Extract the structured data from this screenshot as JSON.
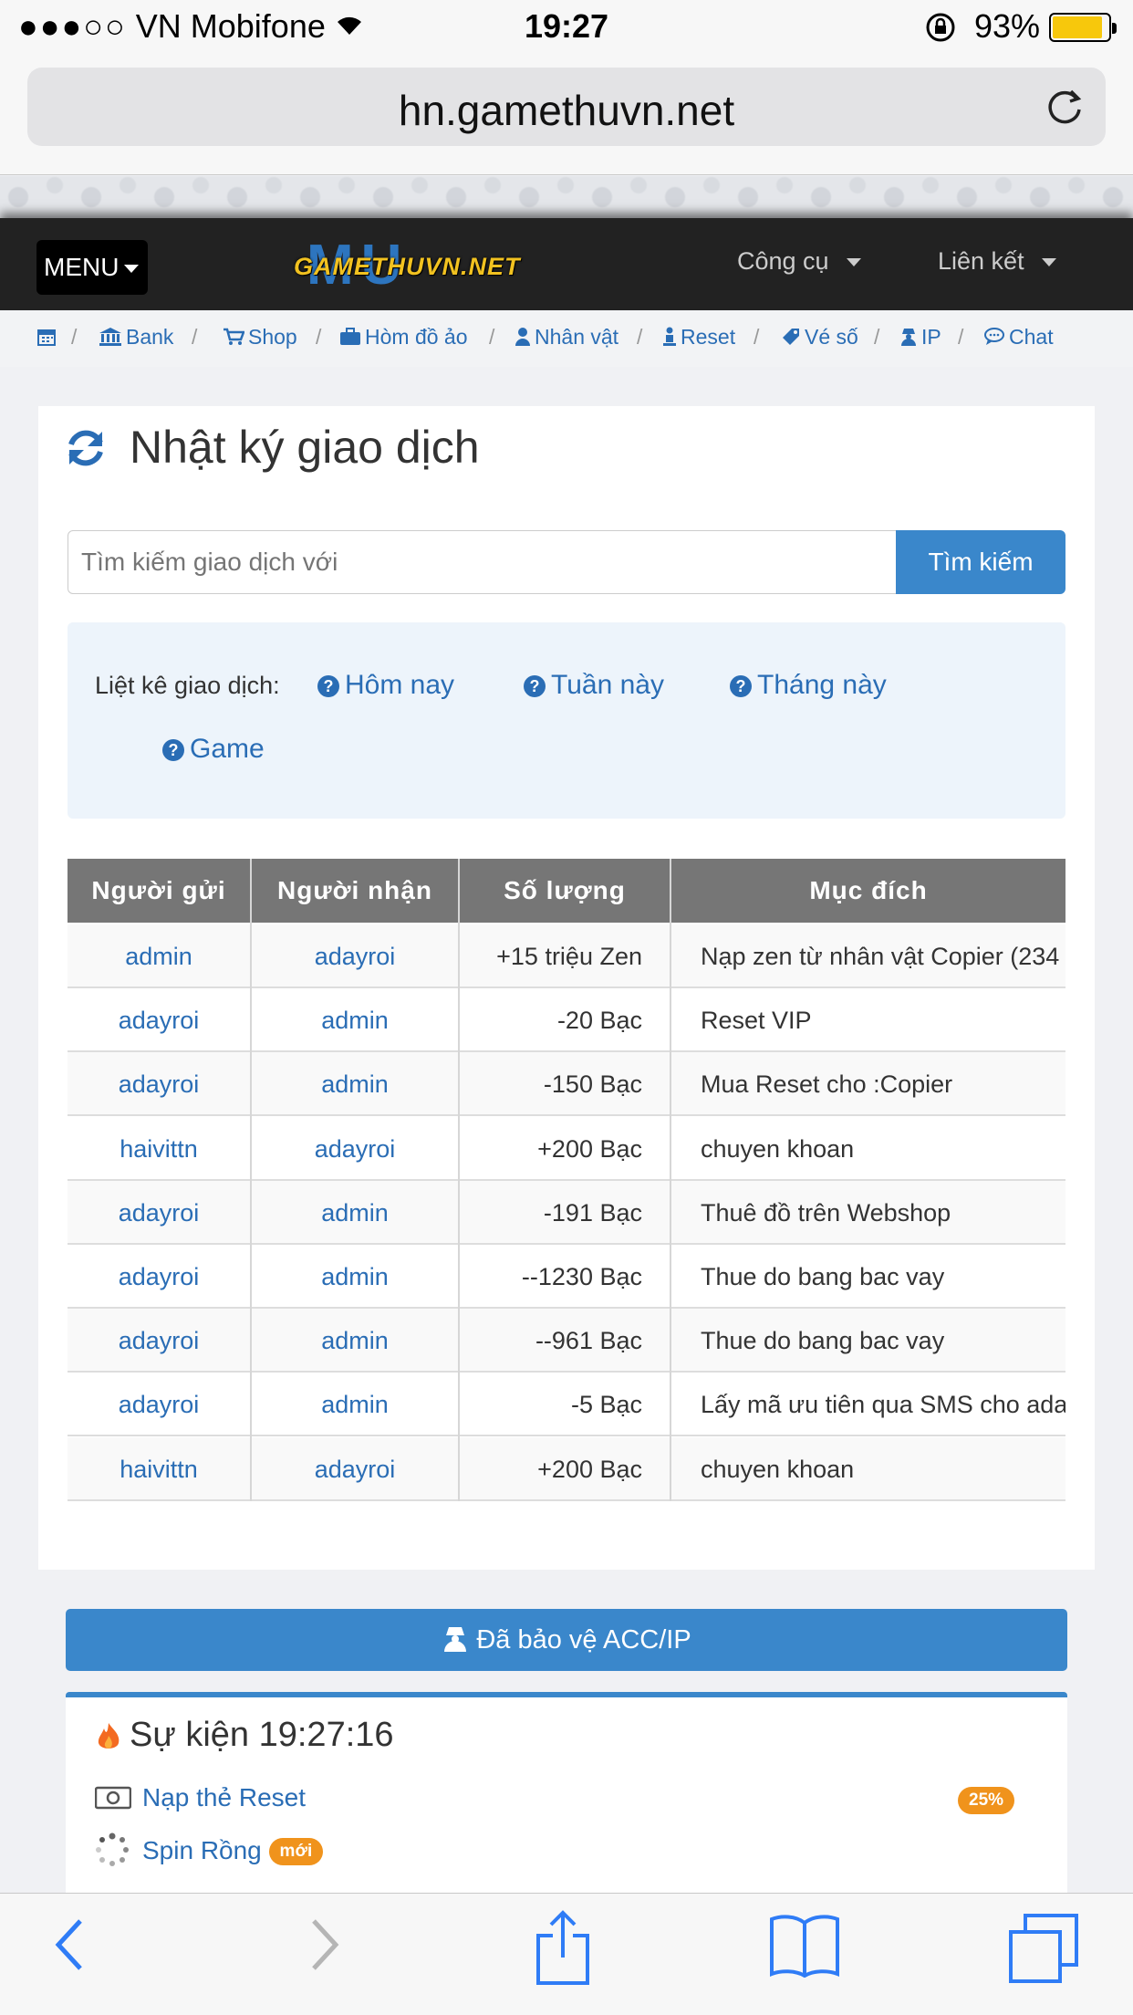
{
  "status_bar": {
    "signal": "●●●○○",
    "carrier": "VN Mobifone",
    "time": "19:27",
    "battery_percent": "93%"
  },
  "browser": {
    "url": "hn.gamethuvn.net"
  },
  "navbar": {
    "menu_label": "MENU",
    "logo_text": "GAMETHUVN.NET",
    "logo_mark": "MU",
    "tools_label": "Công cụ",
    "links_label": "Liên kết"
  },
  "breadcrumb": [
    {
      "label": "Bank",
      "icon": "bank-icon"
    },
    {
      "label": "Shop",
      "icon": "cart-icon"
    },
    {
      "label": "Hòm đồ ảo",
      "icon": "briefcase-icon"
    },
    {
      "label": "Nhân vật",
      "icon": "user-icon"
    },
    {
      "label": "Reset",
      "icon": "person-icon"
    },
    {
      "label": "Vé số",
      "icon": "ticket-icon"
    },
    {
      "label": "IP",
      "icon": "spy-icon"
    },
    {
      "label": "Chat",
      "icon": "chat-icon"
    }
  ],
  "main": {
    "title": "Nhật ký giao dịch",
    "search_placeholder": "Tìm kiếm giao dịch với",
    "search_button": "Tìm kiếm",
    "filter_label": "Liệt kê giao dịch:",
    "filters": [
      "Hôm nay",
      "Tuần này",
      "Tháng này",
      "Game"
    ]
  },
  "table": {
    "headers": [
      "Người gửi",
      "Người nhận",
      "Số lượng",
      "Mục đích"
    ],
    "rows": [
      {
        "sender": "admin",
        "receiver": "adayroi",
        "amount": "+15  triệu Zen",
        "purpose": "Nạp zen từ nhân vật Copier (234"
      },
      {
        "sender": "adayroi",
        "receiver": "admin",
        "amount": "-20  Bạc",
        "purpose": "Reset VIP"
      },
      {
        "sender": "adayroi",
        "receiver": "admin",
        "amount": "-150  Bạc",
        "purpose": "Mua Reset cho :Copier"
      },
      {
        "sender": "haivittn",
        "receiver": "adayroi",
        "amount": "+200  Bạc",
        "purpose": "chuyen khoan"
      },
      {
        "sender": "adayroi",
        "receiver": "admin",
        "amount": "-191  Bạc",
        "purpose": "Thuê đồ trên Webshop"
      },
      {
        "sender": "adayroi",
        "receiver": "admin",
        "amount": "--1230  Bạc",
        "purpose": "Thue do bang bac vay"
      },
      {
        "sender": "adayroi",
        "receiver": "admin",
        "amount": "--961  Bạc",
        "purpose": "Thue do bang bac vay"
      },
      {
        "sender": "adayroi",
        "receiver": "admin",
        "amount": "-5  Bạc",
        "purpose": "Lấy mã ưu tiên qua SMS cho ada"
      },
      {
        "sender": "haivittn",
        "receiver": "adayroi",
        "amount": "+200  Bạc",
        "purpose": "chuyen khoan"
      }
    ]
  },
  "protect_button": "Đã bảo vệ ACC/IP",
  "events": {
    "title": "Sự kiện 19:27:16",
    "items": [
      {
        "label": "Nạp thẻ Reset",
        "badge": "25%"
      },
      {
        "label": "Spin Rồng",
        "badge": "mới"
      }
    ]
  },
  "colors": {
    "link": "#2a6db5",
    "primary": "#3a87cb",
    "badge": "#f0931c",
    "navbar": "#222222"
  }
}
